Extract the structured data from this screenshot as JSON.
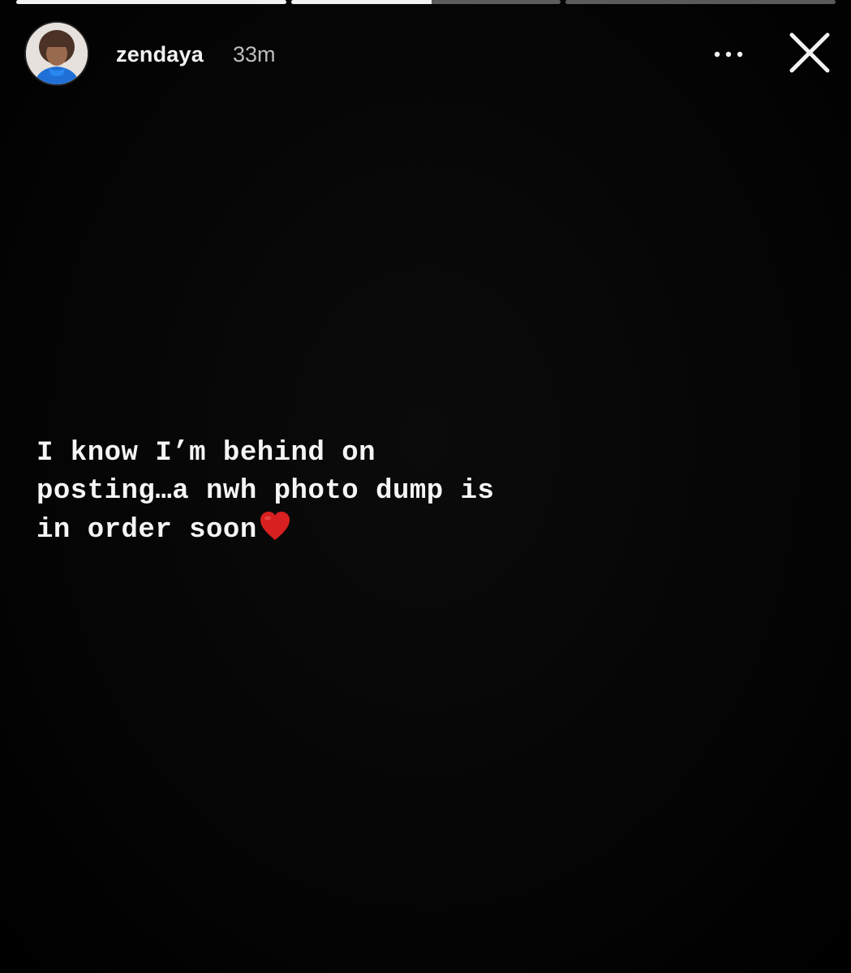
{
  "progress": [
    {
      "fraction": 1.0
    },
    {
      "fraction": 0.52
    },
    {
      "fraction": 0.0
    }
  ],
  "header": {
    "username": "zendaya",
    "time": "33m",
    "more_icon": "more-horizontal-icon",
    "close_icon": "close-icon"
  },
  "story": {
    "lines": [
      "I know I’m behind on",
      "posting…a nwh photo dump is",
      "in order soon"
    ],
    "emoji": "heart-icon",
    "heart_color": "#d82020"
  },
  "colors": {
    "background": "#000000",
    "text": "#f5f5f5",
    "time_text": "#bdbdbd"
  }
}
